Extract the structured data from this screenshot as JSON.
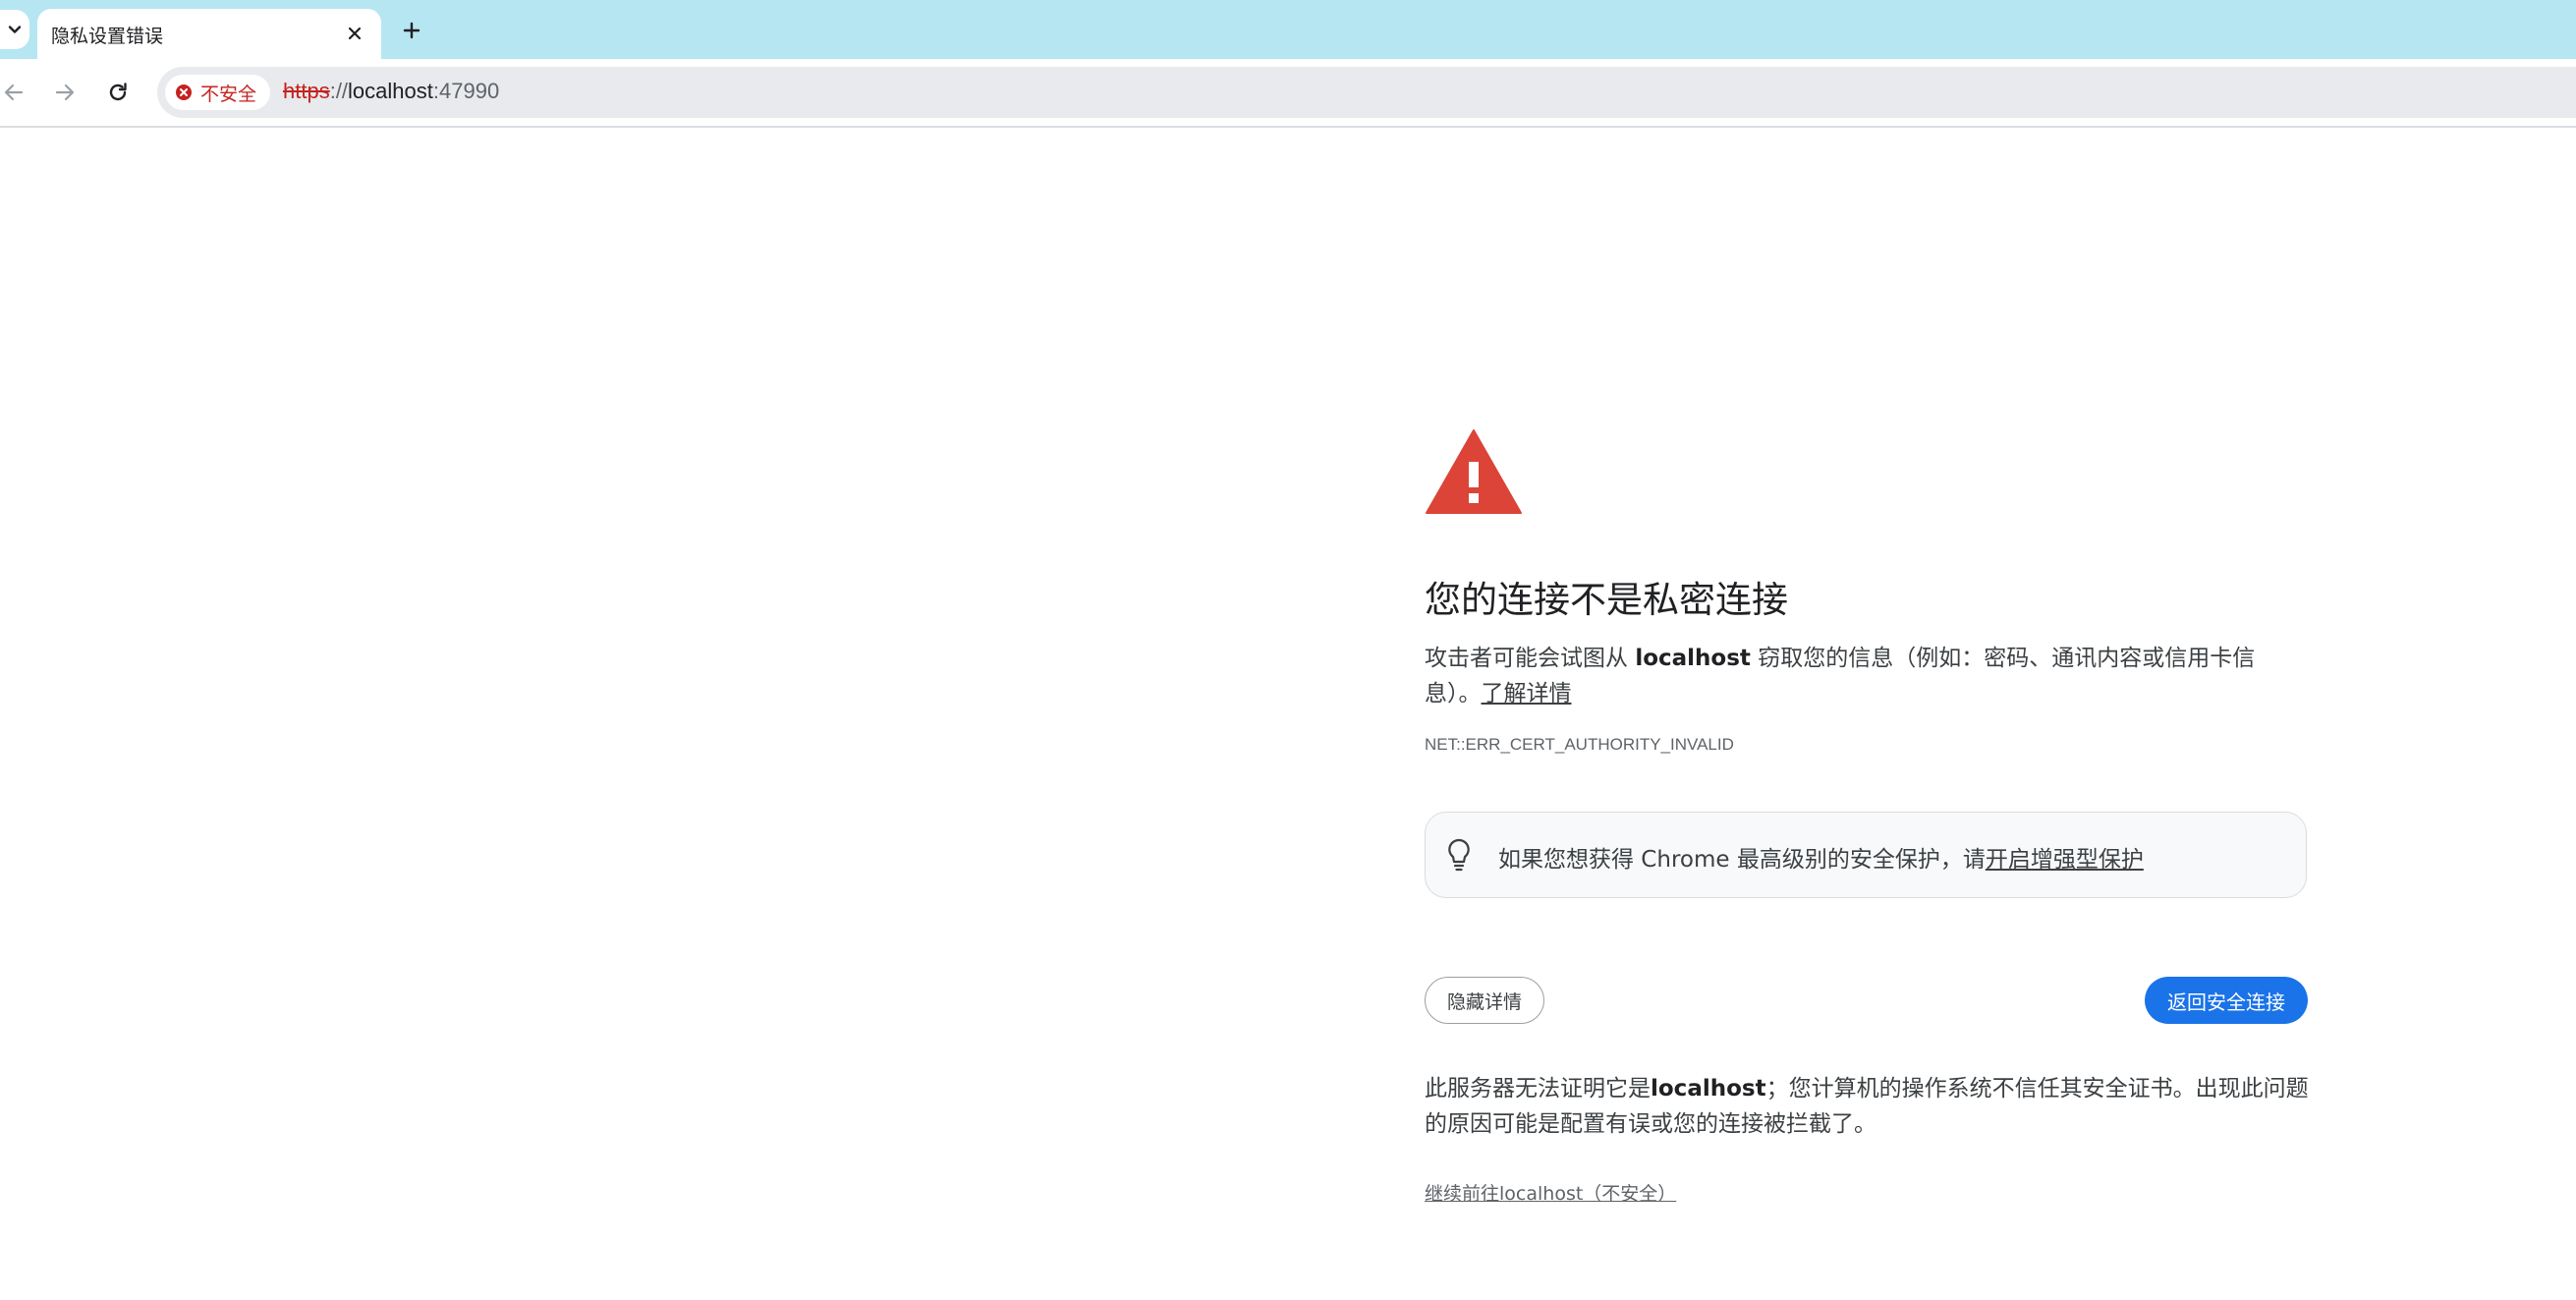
{
  "tab": {
    "title": "隐私设置错误"
  },
  "toolbar": {
    "security_chip_label": "不安全",
    "url_scheme": "https",
    "url_separator": "://",
    "url_host": "localhost",
    "url_port": ":47990"
  },
  "interstitial": {
    "heading": "您的连接不是私密连接",
    "explanation_prefix": "攻击者可能会试图从 ",
    "explanation_host": "localhost",
    "explanation_suffix": " 窃取您的信息（例如：密码、通讯内容或信用卡信息）。",
    "learn_more_link": "了解详情",
    "error_code": "NET::ERR_CERT_AUTHORITY_INVALID",
    "promo_text": "如果您想获得 Chrome 最高级别的安全保护，请",
    "promo_link": "开启增强型保护",
    "hide_details_button": "隐藏详情",
    "back_to_safety_button": "返回安全连接",
    "details_prefix": "此服务器无法证明它是",
    "details_host": "localhost",
    "details_suffix": "；您计算机的操作系统不信任其安全证书。出现此问题的原因可能是配置有误或您的连接被拦截了。",
    "proceed_link": "继续前往localhost（不安全）"
  },
  "colors": {
    "tabstrip_bg": "#b6e6f2",
    "danger_red": "#c5221f",
    "warning_icon_red": "#db4437",
    "primary_blue": "#1a73e8"
  },
  "icons": {
    "tab_dropdown": "chevron-down-icon",
    "tab_close": "close-icon",
    "new_tab": "plus-icon",
    "back": "arrow-left-icon",
    "forward": "arrow-right-icon",
    "reload": "reload-icon",
    "security": "error-circle-icon",
    "warning": "warning-triangle-icon",
    "promo": "lightbulb-icon"
  }
}
